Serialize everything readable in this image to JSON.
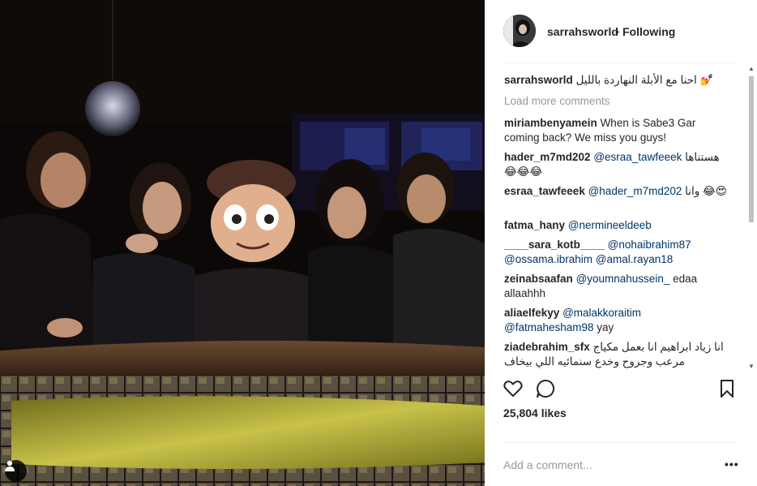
{
  "post": {
    "username": "sarrahsworld",
    "separator": "•",
    "follow_status": "Following"
  },
  "caption": {
    "username": "sarrahsworld",
    "text": "احنا مع الأبلة النهاردة بالليل",
    "emoji": "💅"
  },
  "load_more": "Load more comments",
  "comments": [
    {
      "user": "miriambenyamein",
      "mention": "",
      "text": "When is Sabe3 Gar coming back? We miss you guys!"
    },
    {
      "user": "hader_m7md202",
      "mention": "@esraa_tawfeeek",
      "text": "هستناها 😂😂😂"
    },
    {
      "user": "esraa_tawfeeek",
      "mention": "@hader_m7md202",
      "text": "وانا 😂😍"
    },
    {
      "user": "fatma_hany",
      "mention": "@nermineeldeeb",
      "text": ""
    },
    {
      "user": "____sara_kotb____",
      "mention": "@nohaibrahim87 @ossama.ibrahim @amal.rayan18",
      "text": ""
    },
    {
      "user": "zeinabsaafan",
      "mention": "@youmnahussein_",
      "text": "edaa allaahhh"
    },
    {
      "user": "aliaelfekyy",
      "mention": "@malakkoraitim @fatmahesham98",
      "text": "yay"
    },
    {
      "user": "ziadebrahim_sfx",
      "mention": "",
      "text": "انا زياد ابراهيم انا بعمل مكياج مرعب وجروح وخدع سنمائيه اللي بيخاف"
    }
  ],
  "likes": "25,804 likes",
  "add_comment_placeholder": "Add a comment...",
  "more_options": "•••",
  "icons": {
    "like": "heart-outline-icon",
    "comment": "speech-bubble-icon",
    "save": "bookmark-icon",
    "tagged": "person-tag-icon"
  }
}
